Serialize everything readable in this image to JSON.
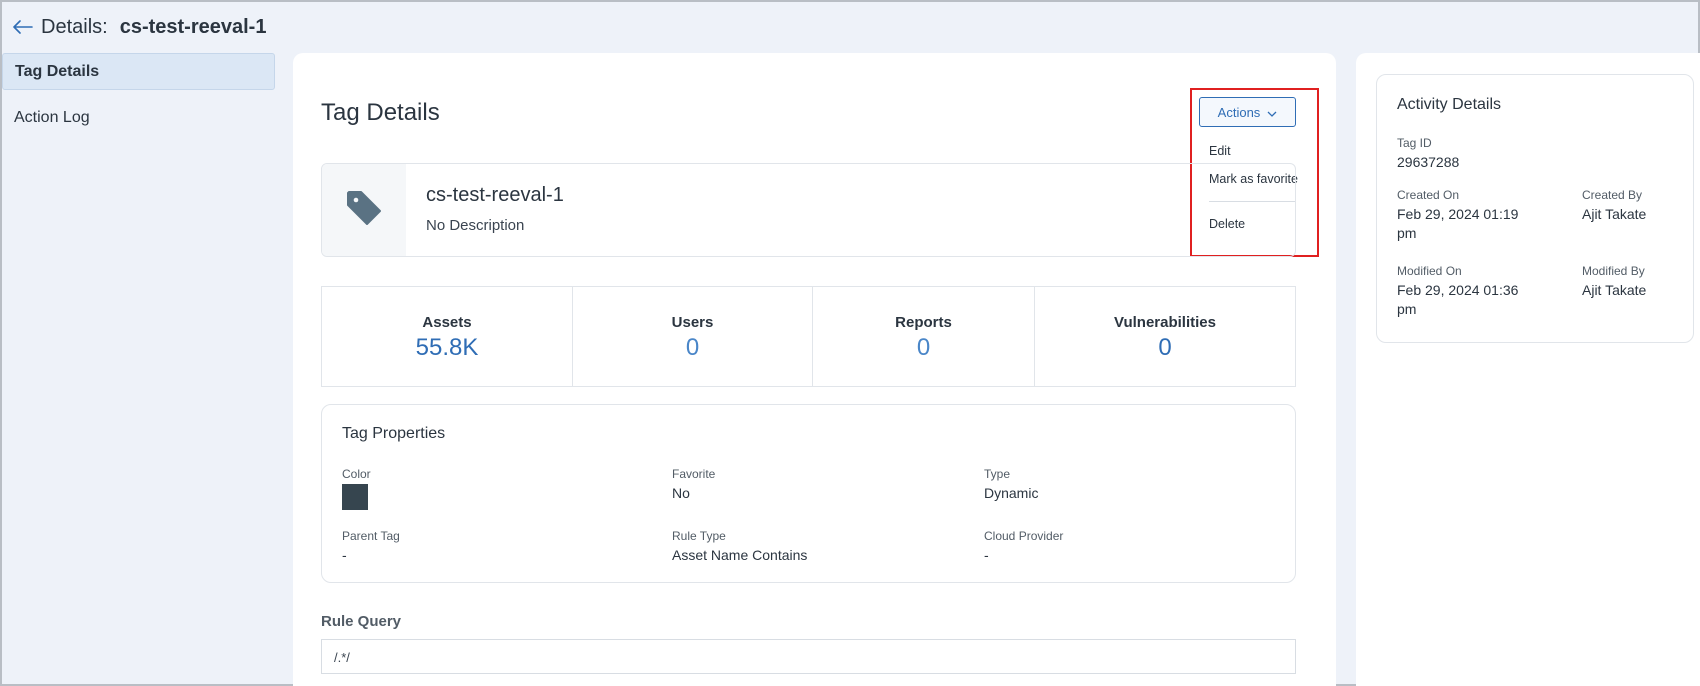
{
  "header": {
    "label": "Details:",
    "title": "cs-test-reeval-1"
  },
  "sidebar": {
    "items": [
      {
        "label": "Tag Details",
        "active": true
      },
      {
        "label": "Action Log",
        "active": false
      }
    ]
  },
  "main": {
    "title": "Tag Details",
    "actions": {
      "button_label": "Actions",
      "menu": [
        "Edit",
        "Mark as favorite",
        "Delete"
      ]
    },
    "tag": {
      "name": "cs-test-reeval-1",
      "description": "No Description"
    },
    "stats": [
      {
        "label": "Assets",
        "value": "55.8K"
      },
      {
        "label": "Users",
        "value": "0"
      },
      {
        "label": "Reports",
        "value": "0"
      },
      {
        "label": "Vulnerabilities",
        "value": "0"
      }
    ],
    "properties": {
      "title": "Tag Properties",
      "color_label": "Color",
      "color_value": "#36454f",
      "favorite_label": "Favorite",
      "favorite_value": "No",
      "type_label": "Type",
      "type_value": "Dynamic",
      "parent_label": "Parent Tag",
      "parent_value": "-",
      "rule_type_label": "Rule Type",
      "rule_type_value": "Asset Name Contains",
      "cloud_label": "Cloud Provider",
      "cloud_value": "-"
    },
    "rule_query": {
      "title": "Rule Query",
      "value": "/.*/"
    }
  },
  "activity": {
    "title": "Activity Details",
    "tag_id_label": "Tag ID",
    "tag_id_value": "29637288",
    "created_on_label": "Created On",
    "created_on_value": "Feb 29, 2024 01:19 pm",
    "created_by_label": "Created By",
    "created_by_value": "Ajit Takate",
    "modified_on_label": "Modified On",
    "modified_on_value": "Feb 29, 2024 01:36 pm",
    "modified_by_label": "Modified By",
    "modified_by_value": "Ajit Takate"
  },
  "colors": {
    "accent": "#2f6db5",
    "highlight": "#e02020",
    "tag_icon": "#5a7283"
  },
  "icons": [
    "arrow-left-icon",
    "chevron-down-icon",
    "tag-icon"
  ]
}
